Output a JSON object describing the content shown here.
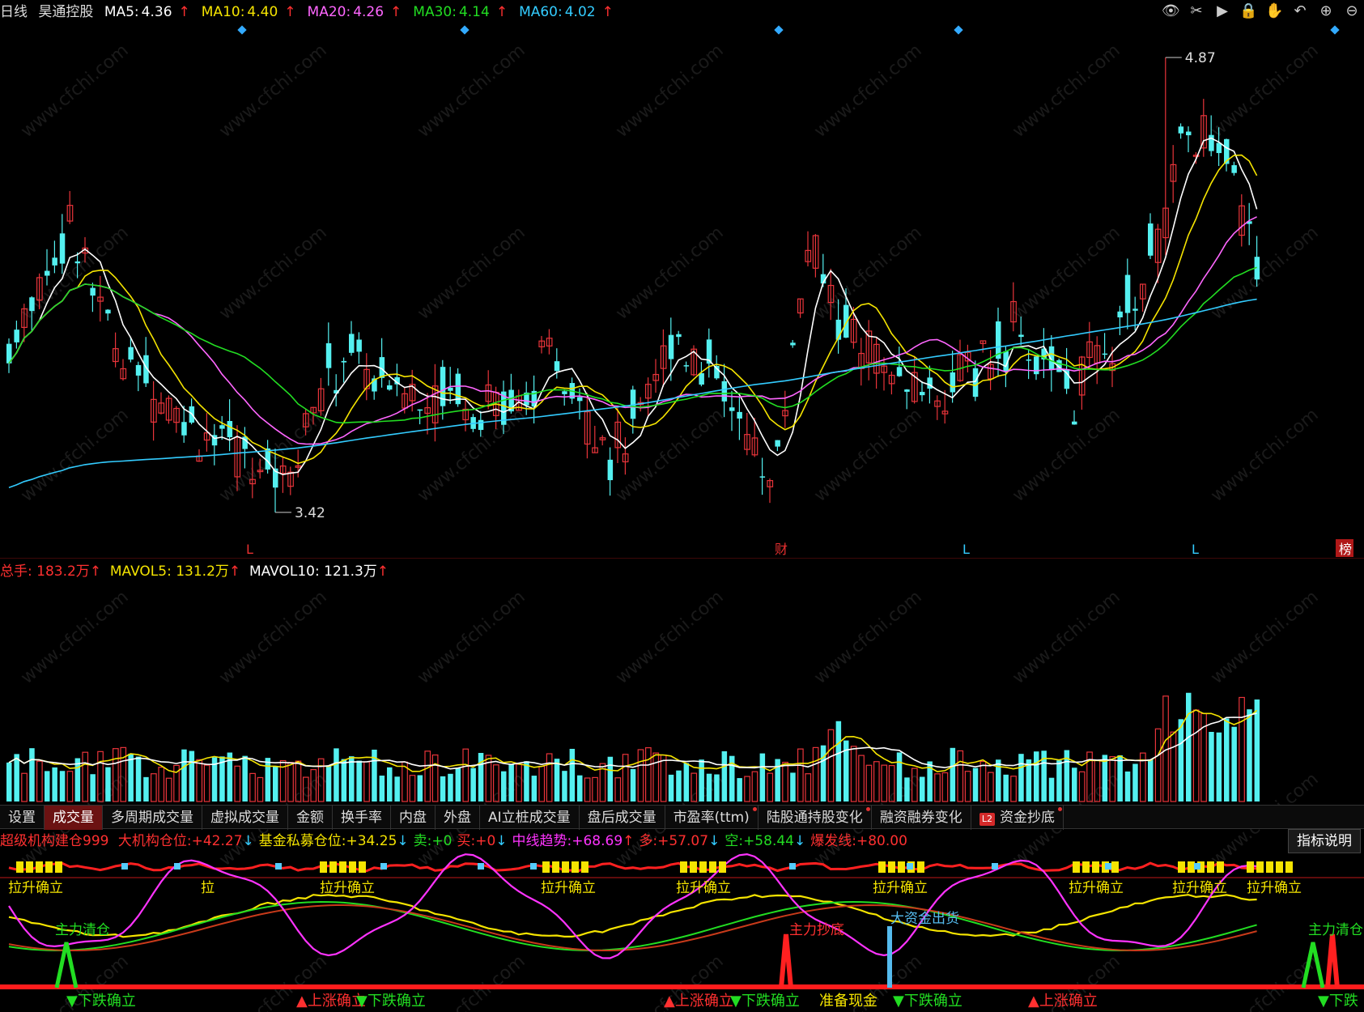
{
  "header": {
    "period": "日线",
    "stock_name": "昊通控股",
    "ma": [
      {
        "label": "MA5:",
        "value": "4.36",
        "arrow": "↑",
        "color": "#ffffff"
      },
      {
        "label": "MA10:",
        "value": "4.40",
        "arrow": "↑",
        "color": "#f5e400"
      },
      {
        "label": "MA20:",
        "value": "4.26",
        "arrow": "↑",
        "color": "#ff66ff"
      },
      {
        "label": "MA30:",
        "value": "4.14",
        "arrow": "↑",
        "color": "#22dd22"
      },
      {
        "label": "MA60:",
        "value": "4.02",
        "arrow": "↑",
        "color": "#33ccff"
      }
    ],
    "toolbar_icons": [
      "eye-icon",
      "scissors-icon",
      "play-icon",
      "lock-icon",
      "hand-icon",
      "undo-icon",
      "zoom-in-icon",
      "zoom-out-icon"
    ]
  },
  "price_chart": {
    "high_label": "4.87",
    "low_label": "3.42",
    "markers": [
      "L",
      "财",
      "L",
      "L",
      "榜"
    ]
  },
  "volume_header": {
    "total_label": "总手:",
    "total_value": "183.2万",
    "mavol5_label": "MAVOL5:",
    "mavol5_value": "131.2万",
    "mavol10_label": "MAVOL10:",
    "mavol10_value": "121.3万",
    "arrow": "↑"
  },
  "tabs": [
    {
      "label": "设置",
      "active": false,
      "dot": false
    },
    {
      "label": "成交量",
      "active": true,
      "dot": false
    },
    {
      "label": "多周期成交量",
      "active": false,
      "dot": false
    },
    {
      "label": "虚拟成交量",
      "active": false,
      "dot": false
    },
    {
      "label": "金额",
      "active": false,
      "dot": false
    },
    {
      "label": "换手率",
      "active": false,
      "dot": false
    },
    {
      "label": "内盘",
      "active": false,
      "dot": false
    },
    {
      "label": "外盘",
      "active": false,
      "dot": false
    },
    {
      "label": "AI立桩成交量",
      "active": false,
      "dot": false
    },
    {
      "label": "盘后成交量",
      "active": false,
      "dot": false
    },
    {
      "label": "市盈率(ttm)",
      "active": false,
      "dot": true
    },
    {
      "label": "陆股通持股变化",
      "active": false,
      "dot": true
    },
    {
      "label": "融资融券变化",
      "active": false,
      "dot": false
    },
    {
      "label": "资金抄底",
      "active": false,
      "dot": true,
      "badge": "L2"
    }
  ],
  "indicator_header": {
    "name": "超级机构建仓999",
    "items": [
      {
        "label": "大机构仓位:",
        "value": "+42.27",
        "arrow": "↓",
        "color": "#ff3030"
      },
      {
        "label": "基金私募仓位:",
        "value": "+34.25",
        "arrow": "↓",
        "color": "#f5e400"
      },
      {
        "label": "卖:",
        "value": "+0",
        "arrow": "",
        "color": "#22dd22"
      },
      {
        "label": "买:",
        "value": "+0",
        "arrow": "↓",
        "color": "#ff3030"
      },
      {
        "label": "中线趋势:",
        "value": "+68.69",
        "arrow": "↑",
        "color": "#ff33ff"
      },
      {
        "label": "多:",
        "value": "+57.07",
        "arrow": "↓",
        "color": "#ff3030"
      },
      {
        "label": "空:",
        "value": "+58.44",
        "arrow": "↓",
        "color": "#22dd22"
      },
      {
        "label": "爆发线:",
        "value": "+80.00",
        "arrow": "",
        "color": "#ff3030"
      }
    ],
    "help_button": "指标说明"
  },
  "indicator_labels": {
    "zhuli_qingcang": "主力清仓",
    "zhuli_chaodi": "主力抄底",
    "dazijin_chuhuo": "大资金出货",
    "la": "拉",
    "la_sheng": "拉升确立"
  },
  "signals": [
    {
      "text": "▼下跌确立",
      "color": "#22dd22"
    },
    {
      "text": "▲上涨确立",
      "color": "#ff3030"
    },
    {
      "text": "▼下跌确立",
      "color": "#22dd22"
    },
    {
      "text": "▲上涨确立",
      "color": "#ff3030"
    },
    {
      "text": "▼下跌确立",
      "color": "#22dd22"
    },
    {
      "text": "准备现金",
      "color": "#f5e400"
    },
    {
      "text": "▼下跌确立",
      "color": "#22dd22"
    },
    {
      "text": "▲上涨确立",
      "color": "#ff3030"
    },
    {
      "text": "▼下跌",
      "color": "#22dd22"
    }
  ],
  "watermark": "www.cfchi.com",
  "colors": {
    "up": "#e8343a",
    "down": "#54f0f0",
    "ma5": "#ffffff",
    "ma10": "#f5e400",
    "ma20": "#ff66ff",
    "ma30": "#22dd22",
    "ma60": "#33ccff"
  }
}
